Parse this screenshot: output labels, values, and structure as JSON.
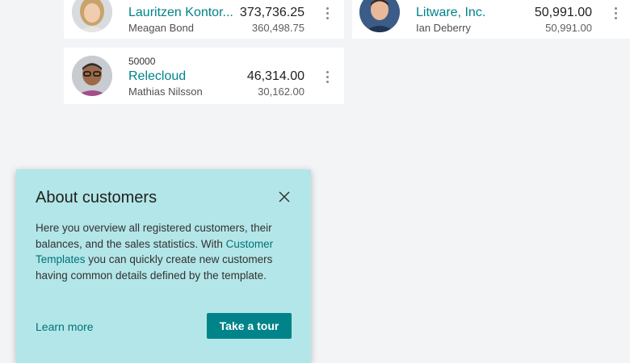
{
  "customers": [
    {
      "no": "",
      "name": "Lauritzen Kontor...",
      "contact": "Meagan Bond",
      "balance": "373,736.25",
      "sub_balance": "360,498.75",
      "avatar_icon": "person-photo-woman"
    },
    {
      "no": "",
      "name": "Litware, Inc.",
      "contact": "Ian Deberry",
      "balance": "50,991.00",
      "sub_balance": "50,991.00",
      "avatar_icon": "person-photo-man"
    },
    {
      "no": "50000",
      "name": "Relecloud",
      "contact": "Mathias Nilsson",
      "balance": "46,314.00",
      "sub_balance": "30,162.00",
      "avatar_icon": "person-photo-man-glasses"
    }
  ],
  "teaching_bubble": {
    "title": "About customers",
    "body_before": "Here you overview all registered customers, their balances, and the sales statistics. With ",
    "body_link": "Customer Templates",
    "body_after": " you can quickly create new customers having common details defined by the template.",
    "learn_more": "Learn more",
    "tour_button": "Take a tour",
    "close_icon": "close-icon"
  },
  "colors": {
    "accent": "#00838a",
    "bubble_bg": "#b3e6e8",
    "button_bg": "#008489",
    "page_bg": "#f3f4f6"
  }
}
